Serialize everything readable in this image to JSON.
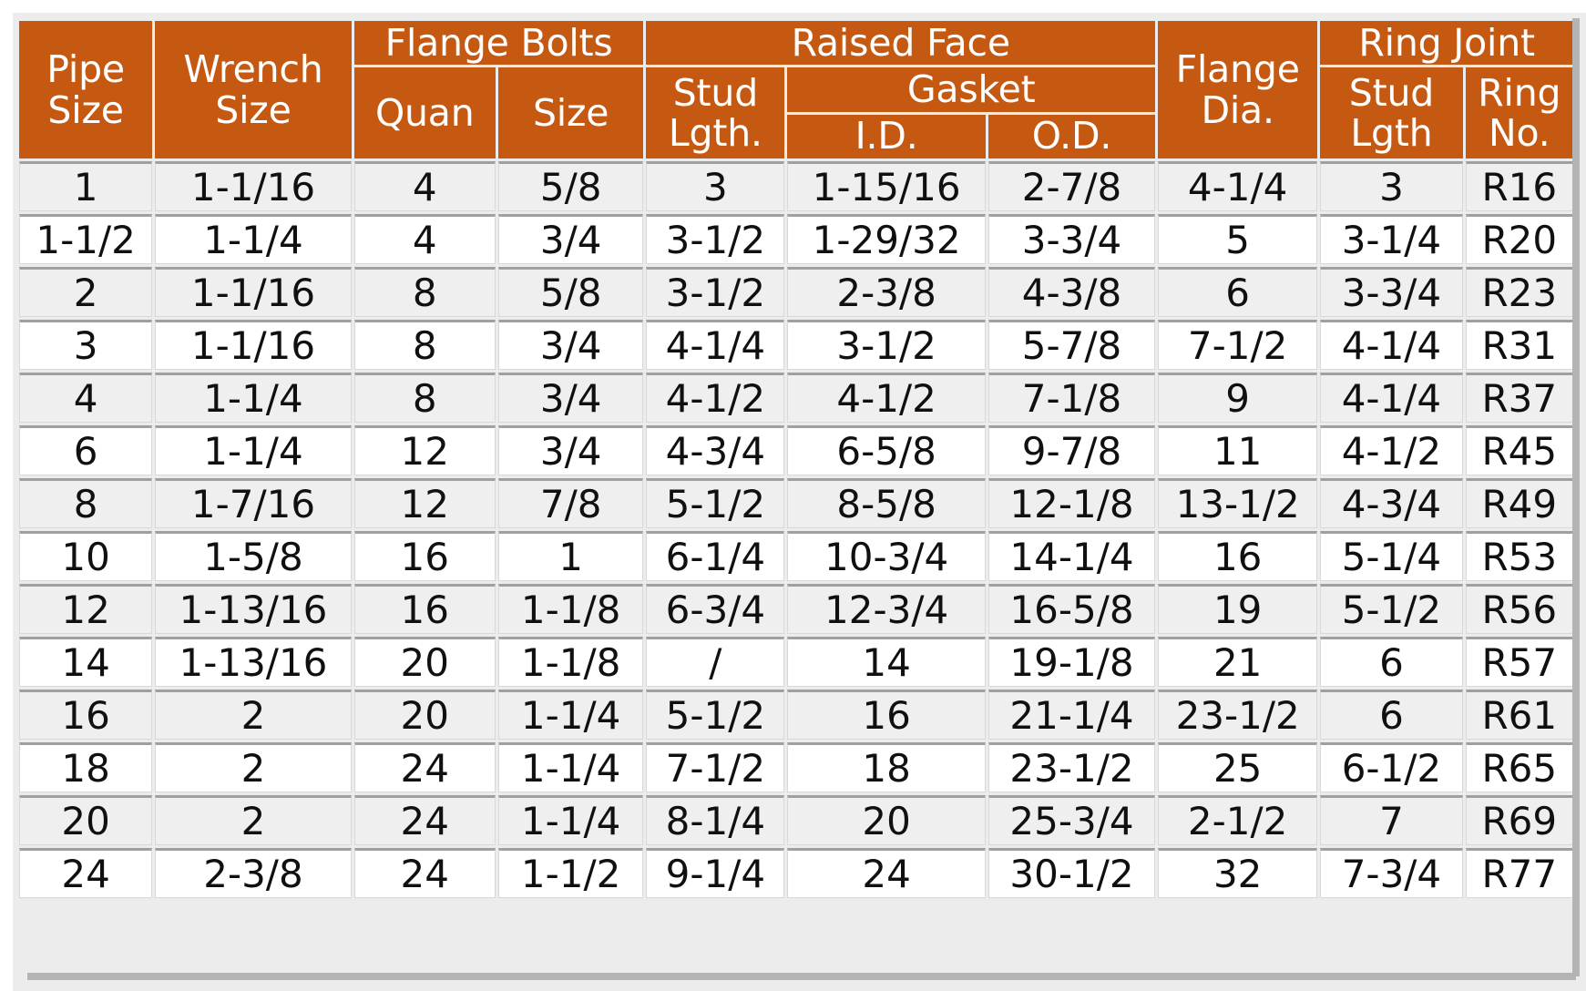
{
  "table": {
    "header": {
      "groups": [
        {
          "label": "Pipe Size",
          "line1": "Pipe",
          "line2": "Size"
        },
        {
          "label": "Wrench Size",
          "line1": "Wrench",
          "line2": "Size"
        },
        {
          "label": "Flange Bolts"
        },
        {
          "label": "Raised Face"
        },
        {
          "label": "Flange Dia.",
          "line1": "Flange",
          "line2": "Dia."
        },
        {
          "label": "Ring Joint"
        }
      ],
      "sub": {
        "quan": "Quan",
        "size": "Size",
        "stud_lgth_line1": "Stud",
        "stud_lgth_line2": "Lgth.",
        "gasket": "Gasket",
        "gasket_id": "I.D.",
        "gasket_od": "O.D.",
        "rj_stud_line1": "Stud",
        "rj_stud_line2": "Lgth",
        "rj_ring_line1": "Ring",
        "rj_ring_line2": "No."
      },
      "columns": [
        "Pipe Size",
        "Wrench Size",
        "Flange Bolts / Quan",
        "Flange Bolts / Size",
        "Raised Face / Stud Lgth.",
        "Raised Face / Gasket / I.D.",
        "Raised Face / Gasket / O.D.",
        "Flange Dia.",
        "Ring Joint / Stud Lgth",
        "Ring Joint / Ring No."
      ]
    },
    "rows": [
      [
        "1",
        "1-1/16",
        "4",
        "5/8",
        "3",
        "1-15/16",
        "2-7/8",
        "4-1/4",
        "3",
        "R16"
      ],
      [
        "1-1/2",
        "1-1/4",
        "4",
        "3/4",
        "3-1/2",
        "1-29/32",
        "3-3/4",
        "5",
        "3-1/4",
        "R20"
      ],
      [
        "2",
        "1-1/16",
        "8",
        "5/8",
        "3-1/2",
        "2-3/8",
        "4-3/8",
        "6",
        "3-3/4",
        "R23"
      ],
      [
        "3",
        "1-1/16",
        "8",
        "3/4",
        "4-1/4",
        "3-1/2",
        "5-7/8",
        "7-1/2",
        "4-1/4",
        "R31"
      ],
      [
        "4",
        "1-1/4",
        "8",
        "3/4",
        "4-1/2",
        "4-1/2",
        "7-1/8",
        "9",
        "4-1/4",
        "R37"
      ],
      [
        "6",
        "1-1/4",
        "12",
        "3/4",
        "4-3/4",
        "6-5/8",
        "9-7/8",
        "11",
        "4-1/2",
        "R45"
      ],
      [
        "8",
        "1-7/16",
        "12",
        "7/8",
        "5-1/2",
        "8-5/8",
        "12-1/8",
        "13-1/2",
        "4-3/4",
        "R49"
      ],
      [
        "10",
        "1-5/8",
        "16",
        "1",
        "6-1/4",
        "10-3/4",
        "14-1/4",
        "16",
        "5-1/4",
        "R53"
      ],
      [
        "12",
        "1-13/16",
        "16",
        "1-1/8",
        "6-3/4",
        "12-3/4",
        "16-5/8",
        "19",
        "5-1/2",
        "R56"
      ],
      [
        "14",
        "1-13/16",
        "20",
        "1-1/8",
        "/",
        "14",
        "19-1/8",
        "21",
        "6",
        "R57"
      ],
      [
        "16",
        "2",
        "20",
        "1-1/4",
        "5-1/2",
        "16",
        "21-1/4",
        "23-1/2",
        "6",
        "R61"
      ],
      [
        "18",
        "2",
        "24",
        "1-1/4",
        "7-1/2",
        "18",
        "23-1/2",
        "25",
        "6-1/2",
        "R65"
      ],
      [
        "20",
        "2",
        "24",
        "1-1/4",
        "8-1/4",
        "20",
        "25-3/4",
        "2-1/2",
        "7",
        "R69"
      ],
      [
        "24",
        "2-3/8",
        "24",
        "1-1/2",
        "9-1/4",
        "24",
        "30-1/2",
        "32",
        "7-3/4",
        "R77"
      ]
    ]
  },
  "colors": {
    "header_background": "#c65911",
    "header_text": "#ffffff",
    "row_odd_background": "#efefef",
    "row_even_background": "#ffffff",
    "grid_line": "#a0a0a0",
    "page_background": "#ececed"
  }
}
